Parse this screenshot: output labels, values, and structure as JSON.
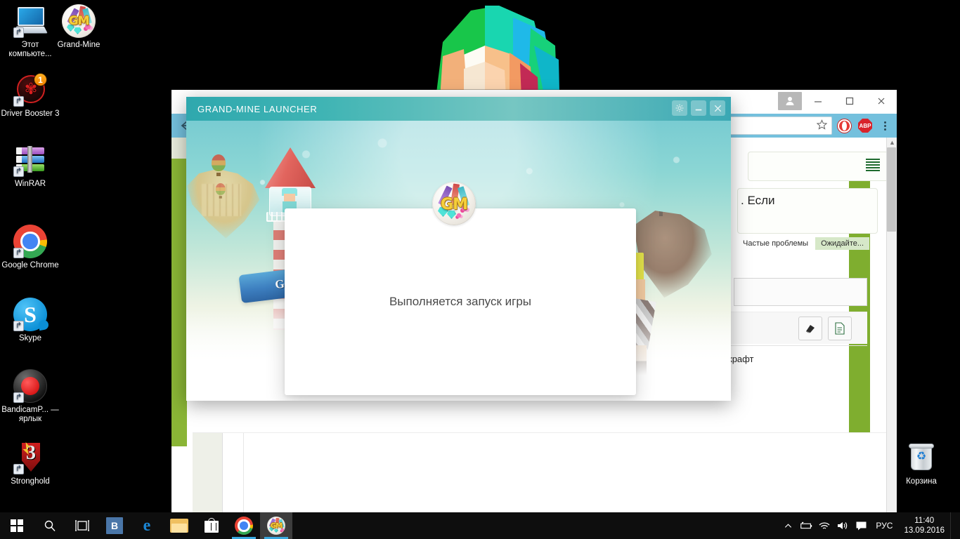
{
  "desktop": {
    "icons": [
      {
        "name": "this-computer",
        "label": "Этот компьюте...",
        "icon": "monitor-icon"
      },
      {
        "name": "grand-mine",
        "label": "Grand-Mine",
        "icon": "grand-mine-icon"
      },
      {
        "name": "driver-booster",
        "label": "Driver Booster 3",
        "icon": "driver-booster-icon",
        "badge": "1"
      },
      {
        "name": "winrar",
        "label": "WinRAR",
        "icon": "winrar-icon"
      },
      {
        "name": "google-chrome",
        "label": "Google Chrome",
        "icon": "chrome-icon"
      },
      {
        "name": "skype",
        "label": "Skype",
        "icon": "skype-icon",
        "glyph": "S"
      },
      {
        "name": "bandicam",
        "label": "BandicamP... — ярлык",
        "icon": "bandicam-icon"
      },
      {
        "name": "stronghold",
        "label": "Stronghold",
        "icon": "stronghold-icon",
        "glyph": "3"
      },
      {
        "name": "recycle-bin",
        "label": "Корзина",
        "icon": "recycle-bin-icon"
      }
    ]
  },
  "browser": {
    "window_controls": {
      "minimize": "—",
      "maximize": "□",
      "close": "✕"
    },
    "profile_icon": "user-avatar-icon",
    "toolbar": {
      "back_icon": "back-arrow-icon",
      "omnibox_value": "",
      "omnibox_placeholder": "",
      "star_icon": "bookmark-star-icon",
      "extensions": [
        {
          "name": "opera-extension",
          "label": ""
        },
        {
          "name": "adblock-plus-extension",
          "label": "ABP"
        }
      ],
      "menu_icon": "three-dot-menu-icon"
    },
    "page": {
      "list_icon": "list-view-icon",
      "text_fragment": ". Если",
      "tabs": [
        {
          "label": "Частые проблемы",
          "active": false
        },
        {
          "label": "Ожидайте...",
          "active": true
        }
      ],
      "buttons": [
        {
          "name": "eraser-button",
          "icon": "eraser-icon"
        },
        {
          "name": "document-button",
          "icon": "document-icon"
        }
      ],
      "text_bottom": "крафт"
    }
  },
  "launcher": {
    "title": "GRAND-MINE LAUNCHER",
    "controls": {
      "settings": "⚙",
      "minimize": "▁",
      "close": "✕"
    },
    "banner_text": "Grand-Mine",
    "logo_text": "GM",
    "modal": {
      "message": "Выполняется запуск игры"
    }
  },
  "taskbar": {
    "start_icon": "windows-start-icon",
    "search_icon": "search-icon",
    "taskview_icon": "task-view-icon",
    "items": [
      {
        "name": "vk-app",
        "label": "B",
        "icon": "vk-icon"
      },
      {
        "name": "microsoft-edge",
        "label": "e",
        "icon": "edge-icon"
      },
      {
        "name": "file-explorer",
        "label": "",
        "icon": "folder-icon"
      },
      {
        "name": "microsoft-store",
        "label": "",
        "icon": "store-icon"
      },
      {
        "name": "google-chrome",
        "label": "",
        "icon": "chrome-icon"
      },
      {
        "name": "grand-mine-launcher",
        "label": "",
        "icon": "grand-mine-icon"
      }
    ],
    "tray": {
      "chevron": "⌃",
      "battery_icon": "battery-icon",
      "wifi_icon": "wifi-icon",
      "volume_icon": "volume-icon",
      "notifications_icon": "notifications-icon",
      "language": "РУС",
      "time": "11:40",
      "date": "13.09.2016"
    }
  }
}
